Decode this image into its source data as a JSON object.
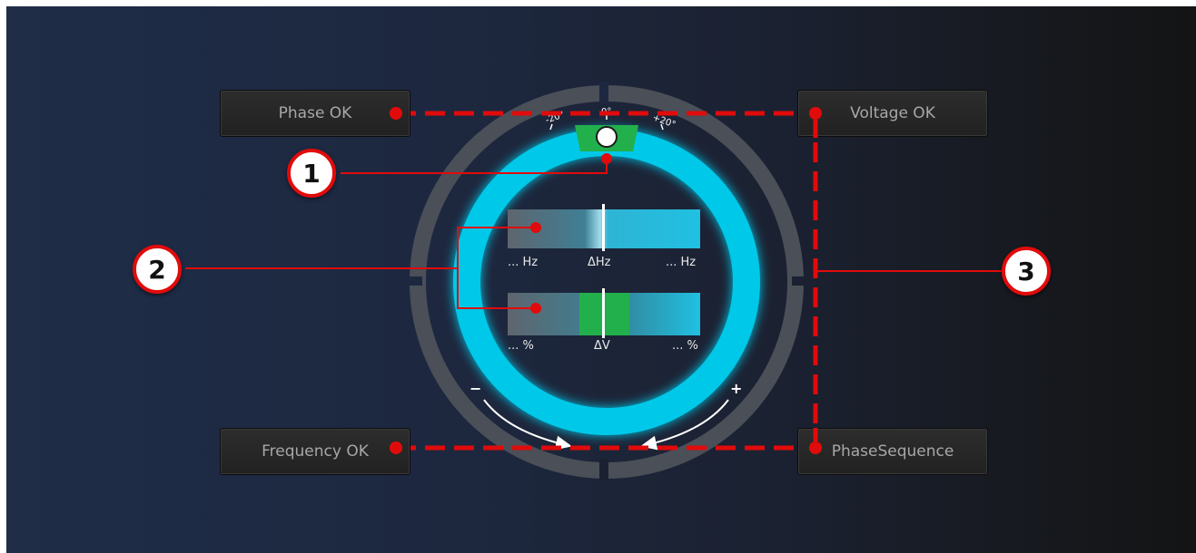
{
  "buttons": {
    "phase_ok": "Phase OK",
    "voltage_ok": "Voltage OK",
    "frequency_ok": "Frequency OK",
    "phase_sequence": "PhaseSequence"
  },
  "phase_dial": {
    "tick_left": "-20°",
    "tick_center": "0°",
    "tick_right": "+20°",
    "minus_sign": "−",
    "plus_sign": "+"
  },
  "frequency_bar": {
    "left_label": "... Hz",
    "center_label": "ΔHz",
    "right_label": "... Hz"
  },
  "voltage_bar": {
    "left_label": "... %",
    "center_label": "ΔV",
    "right_label": "... %"
  },
  "callouts": [
    "1",
    "2",
    "3"
  ],
  "colors": {
    "ring": "#00c8e8",
    "ok_green": "#22b04c",
    "callout_red": "#e10b0b",
    "outer_ring": "#4a4f58"
  }
}
